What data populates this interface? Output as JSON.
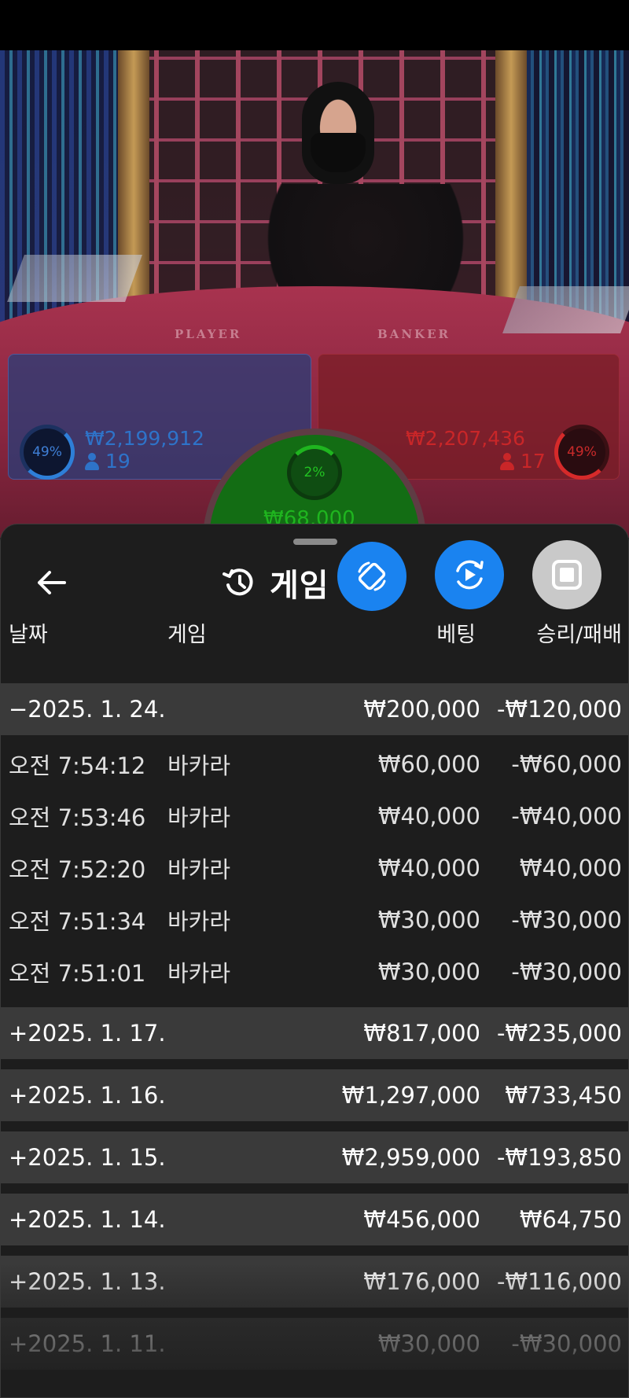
{
  "video": {
    "table_player_label": "PLAYER",
    "table_banker_label": "BANKER",
    "player": {
      "percent": "49%",
      "amount": "₩2,199,912",
      "count": "19"
    },
    "banker": {
      "percent": "49%",
      "amount": "₩2,207,436",
      "count": "17"
    },
    "tie": {
      "percent": "2%",
      "amount": "₩68,000"
    },
    "colors": {
      "player": "#2e73c9",
      "banker": "#c92628",
      "tie": "#1fb51f"
    }
  },
  "sheet": {
    "title": "게임",
    "title_icon": "history-icon",
    "back_icon": "arrow-left-icon",
    "fab_icons": [
      "rotate-screen-icon",
      "replay-icon",
      "stop-icon"
    ],
    "fab_colors": [
      "#1a83f0",
      "#1a83f0",
      "#c9c9c9"
    ],
    "headers": {
      "date": "날짜",
      "game": "게임",
      "bet": "베팅",
      "result": "승리/패배"
    },
    "days": [
      {
        "date": "−2025. 1. 24.",
        "bet": "₩200,000",
        "result": "-₩120,000",
        "expanded": true,
        "games": [
          {
            "time": "오전 7:54:12",
            "game": "바카라",
            "bet": "₩60,000",
            "result": "-₩60,000"
          },
          {
            "time": "오전 7:53:46",
            "game": "바카라",
            "bet": "₩40,000",
            "result": "-₩40,000"
          },
          {
            "time": "오전 7:52:20",
            "game": "바카라",
            "bet": "₩40,000",
            "result": "₩40,000"
          },
          {
            "time": "오전 7:51:34",
            "game": "바카라",
            "bet": "₩30,000",
            "result": "-₩30,000"
          },
          {
            "time": "오전 7:51:01",
            "game": "바카라",
            "bet": "₩30,000",
            "result": "-₩30,000"
          }
        ]
      },
      {
        "date": "+2025. 1. 17.",
        "bet": "₩817,000",
        "result": "-₩235,000",
        "expanded": false
      },
      {
        "date": "+2025. 1. 16.",
        "bet": "₩1,297,000",
        "result": "₩733,450",
        "expanded": false
      },
      {
        "date": "+2025. 1. 15.",
        "bet": "₩2,959,000",
        "result": "-₩193,850",
        "expanded": false
      },
      {
        "date": "+2025. 1. 14.",
        "bet": "₩456,000",
        "result": "₩64,750",
        "expanded": false
      },
      {
        "date": "+2025. 1. 13.",
        "bet": "₩176,000",
        "result": "-₩116,000",
        "expanded": false
      },
      {
        "date": "+2025. 1. 11.",
        "bet": "₩30,000",
        "result": "-₩30,000",
        "expanded": false
      }
    ]
  }
}
